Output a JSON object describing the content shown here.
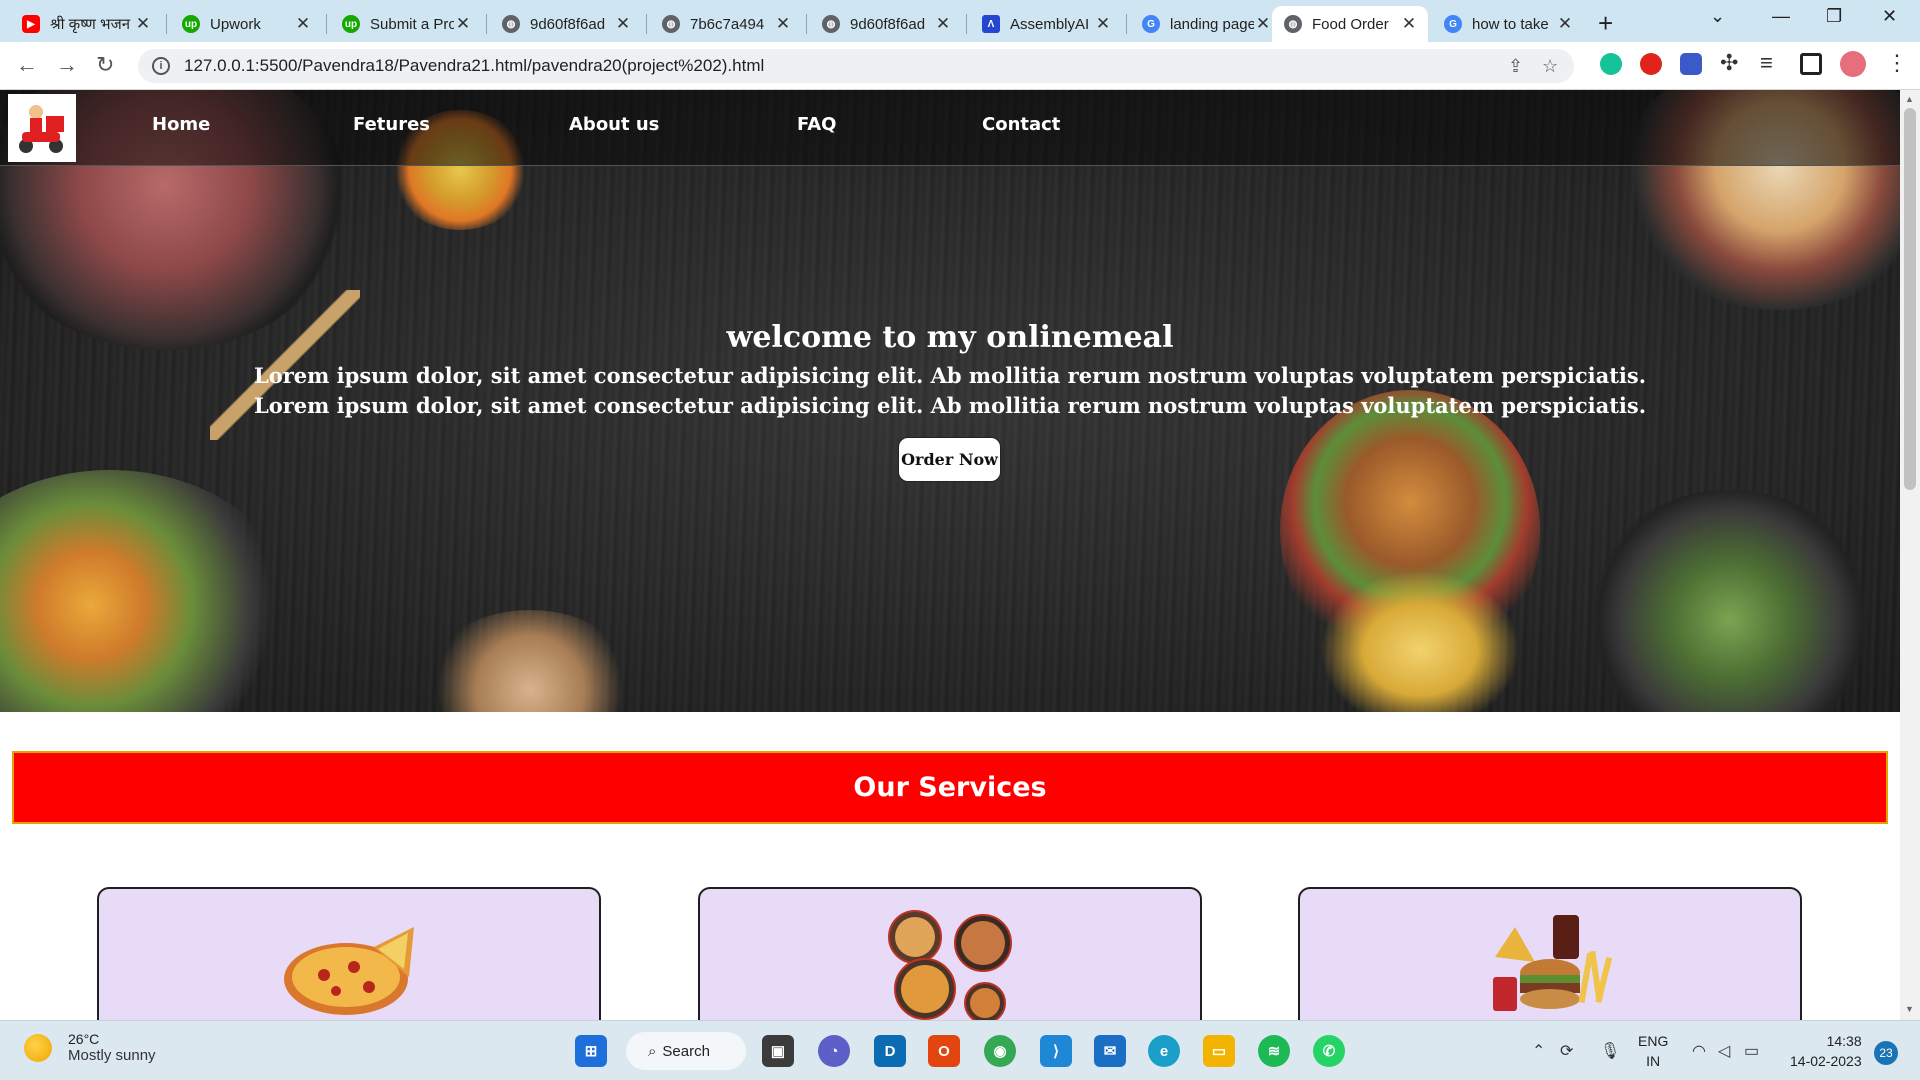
{
  "browser": {
    "tabs": [
      {
        "title": "श्री कृष्ण भजन",
        "icon": "youtube-icon",
        "color": "#ff0000"
      },
      {
        "title": "Upwork",
        "icon": "upwork-icon",
        "color": "#14a800"
      },
      {
        "title": "Submit a Proposal",
        "icon": "upwork-icon",
        "color": "#14a800"
      },
      {
        "title": "9d60f8f6ad",
        "icon": "globe-icon",
        "color": "#5f6368"
      },
      {
        "title": "7b6c7a494",
        "icon": "globe-icon",
        "color": "#5f6368"
      },
      {
        "title": "9d60f8f6ad",
        "icon": "globe-icon",
        "color": "#5f6368"
      },
      {
        "title": "AssemblyAI",
        "icon": "assemblyai-icon",
        "color": "#2545d3"
      },
      {
        "title": "landing page",
        "icon": "google-icon",
        "color": "#4285f4"
      },
      {
        "title": "Food Order",
        "icon": "globe-icon",
        "color": "#5f6368",
        "active": true
      },
      {
        "title": "how to take",
        "icon": "google-icon",
        "color": "#4285f4"
      }
    ],
    "url": "127.0.0.1:5500/Pavendra18/Pavendra21.html/pavendra20(project%202).html"
  },
  "nav": {
    "logo": "food-delivery-logo",
    "links": [
      "Home",
      "Fetures",
      "About us",
      "FAQ",
      "Contact"
    ]
  },
  "hero": {
    "title": "welcome to my onlinemeal",
    "line1": "Lorem ipsum dolor, sit amet consectetur adipisicing elit. Ab mollitia rerum nostrum voluptas voluptatem perspiciatis.",
    "line2": "Lorem ipsum dolor, sit amet consectetur adipisicing elit. Ab mollitia rerum nostrum voluptas voluptatem perspiciatis.",
    "button": "Order Now"
  },
  "services": {
    "heading": "Our Services",
    "accent": "#ff0000",
    "card_bg": "#e8dbf7",
    "cards": [
      {
        "image": "pizza-image"
      },
      {
        "image": "thali-dishes-image"
      },
      {
        "image": "fast-food-image"
      }
    ]
  },
  "taskbar": {
    "weather_temp": "26°C",
    "weather_desc": "Mostly sunny",
    "search_label": "Search",
    "lang": "ENG",
    "region": "IN",
    "time": "14:38",
    "date": "14-02-2023",
    "notifications": "23"
  }
}
